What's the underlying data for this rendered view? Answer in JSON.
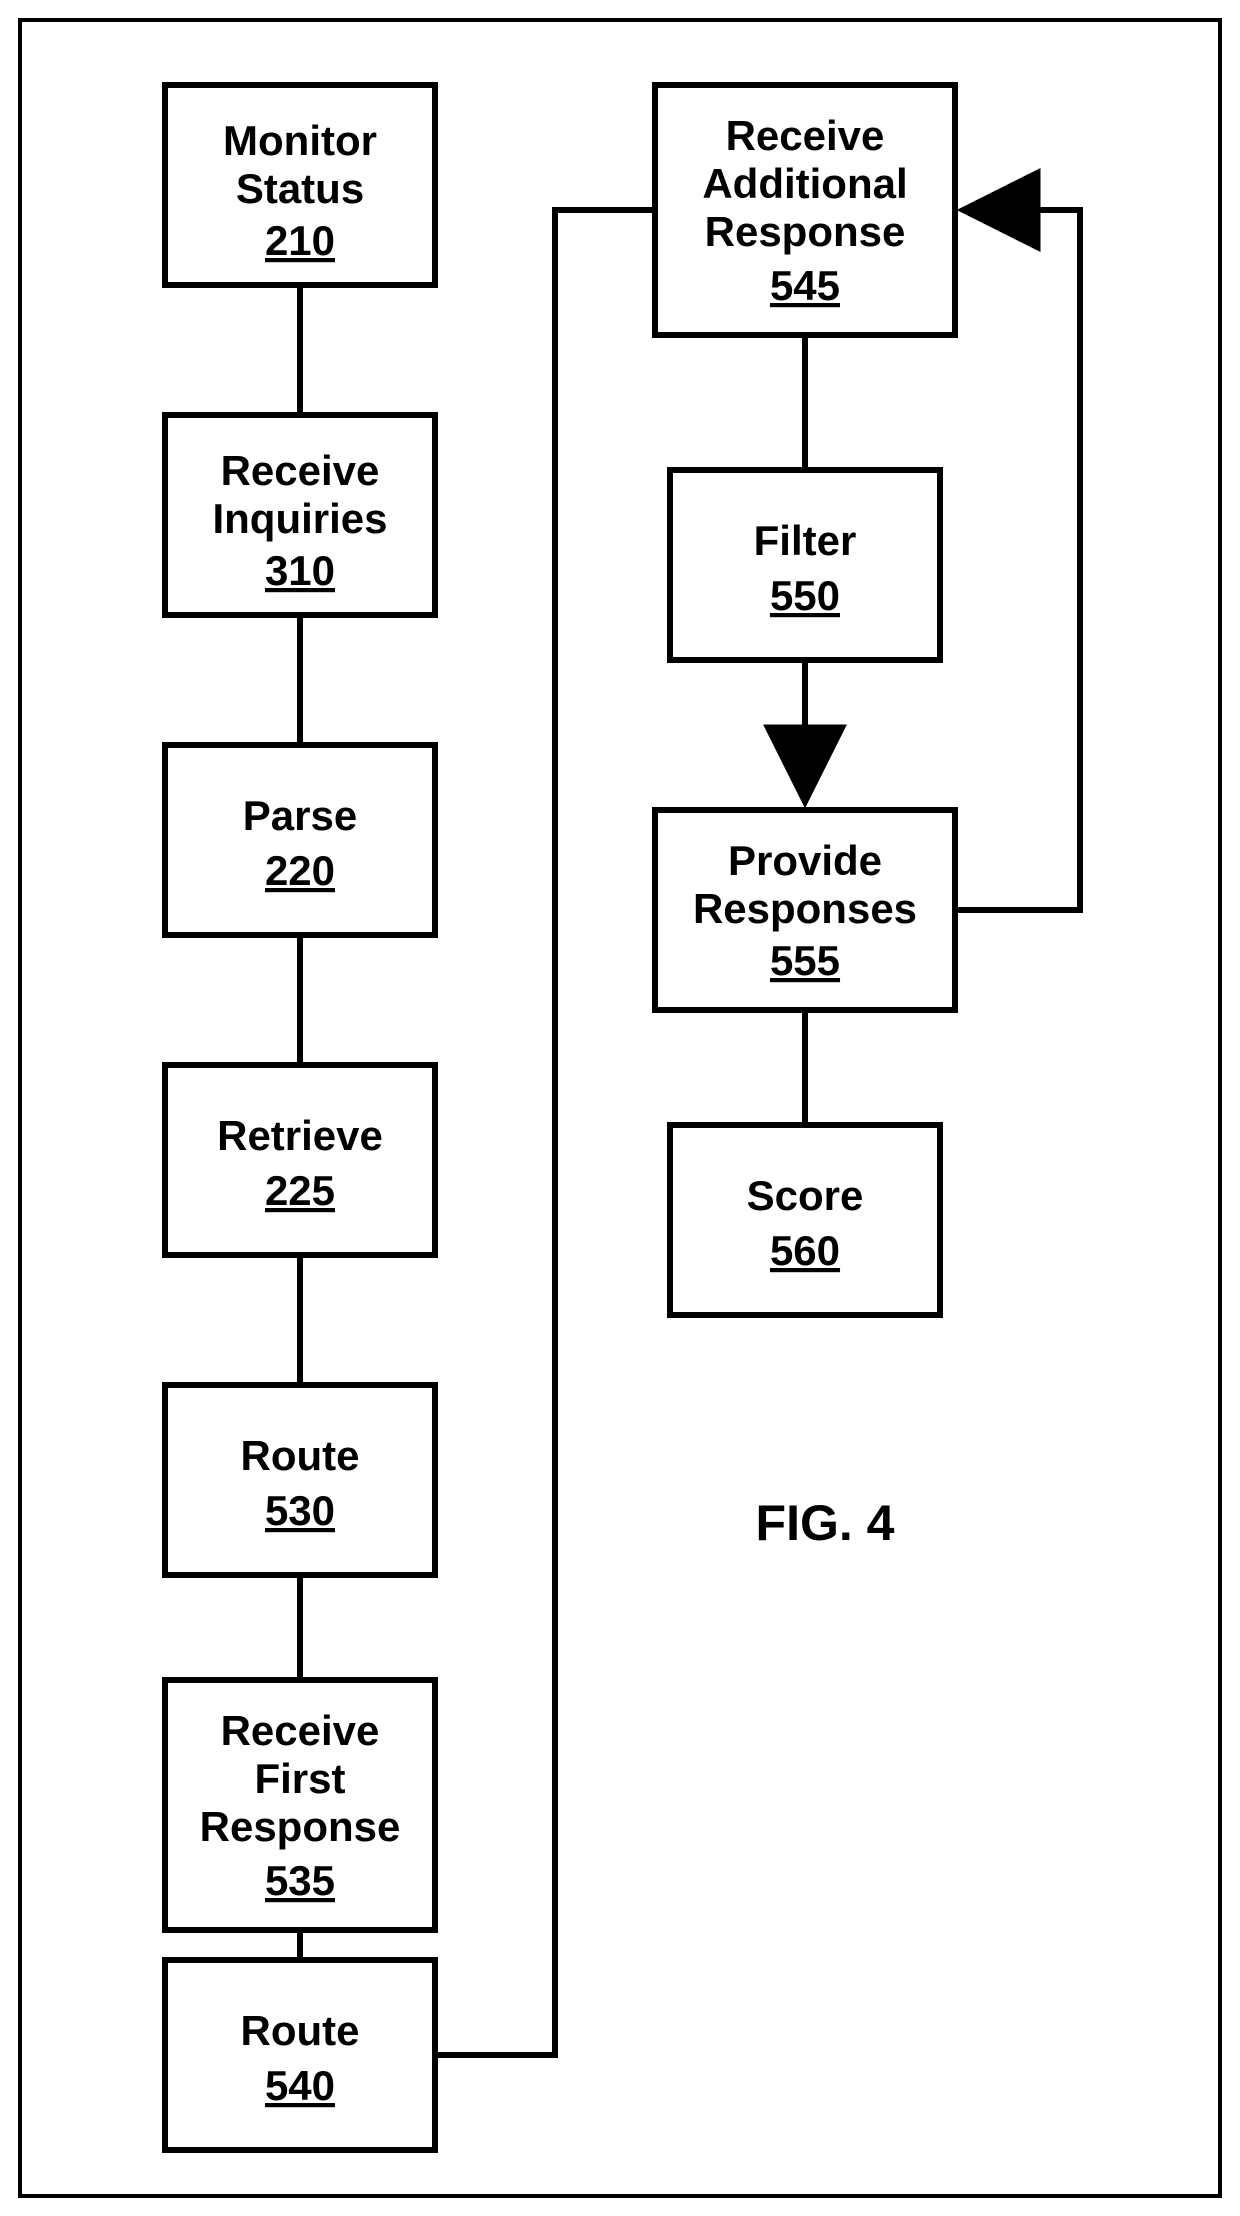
{
  "figure_label": "FIG. 4",
  "nodes": {
    "n210": {
      "lines": [
        "Monitor",
        "Status"
      ],
      "num": "210"
    },
    "n310": {
      "lines": [
        "Receive",
        "Inquiries"
      ],
      "num": "310"
    },
    "n220": {
      "lines": [
        "Parse"
      ],
      "num": "220"
    },
    "n225": {
      "lines": [
        "Retrieve"
      ],
      "num": "225"
    },
    "n530": {
      "lines": [
        "Route"
      ],
      "num": "530"
    },
    "n535": {
      "lines": [
        "Receive",
        "First",
        "Response"
      ],
      "num": "535"
    },
    "n540": {
      "lines": [
        "Route"
      ],
      "num": "540"
    },
    "n545": {
      "lines": [
        "Receive",
        "Additional",
        "Response"
      ],
      "num": "545"
    },
    "n550": {
      "lines": [
        "Filter"
      ],
      "num": "550"
    },
    "n555": {
      "lines": [
        "Provide",
        "Responses"
      ],
      "num": "555"
    },
    "n560": {
      "lines": [
        "Score"
      ],
      "num": "560"
    }
  }
}
